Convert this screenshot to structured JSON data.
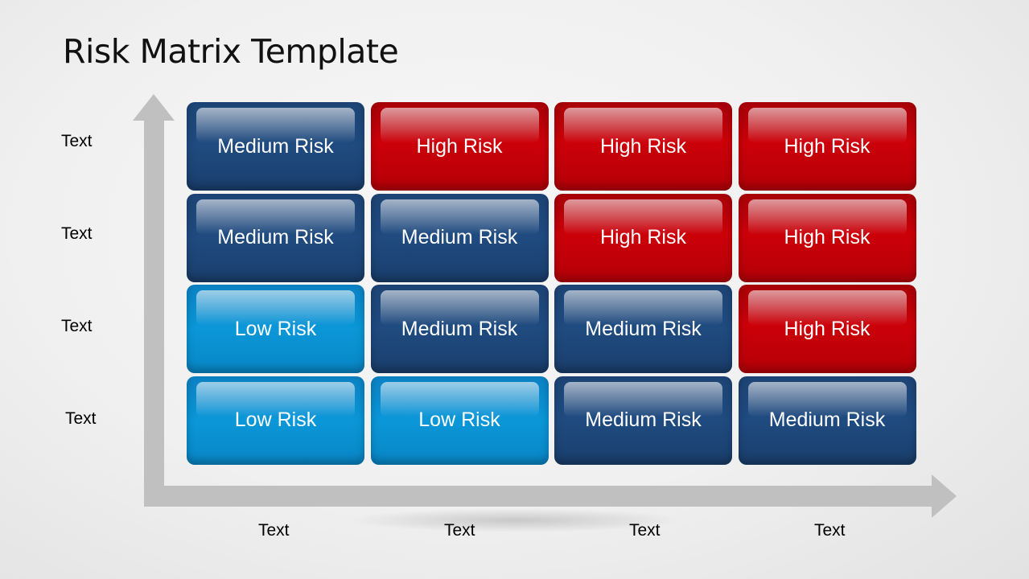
{
  "title": "Risk Matrix Template",
  "colors": {
    "medium": "#1f4b80",
    "high": "#cc0009",
    "low": "#0a97d8",
    "axis": "#c0c0c0"
  },
  "y_labels": [
    "Text",
    "Text",
    "Text",
    "Text"
  ],
  "x_labels": [
    "Text",
    "Text",
    "Text",
    "Text"
  ],
  "matrix": [
    [
      {
        "label": "Medium Risk",
        "level": "medium"
      },
      {
        "label": "High Risk",
        "level": "high"
      },
      {
        "label": "High Risk",
        "level": "high"
      },
      {
        "label": "High Risk",
        "level": "high"
      }
    ],
    [
      {
        "label": "Medium Risk",
        "level": "medium"
      },
      {
        "label": "Medium Risk",
        "level": "medium"
      },
      {
        "label": "High Risk",
        "level": "high"
      },
      {
        "label": "High Risk",
        "level": "high"
      }
    ],
    [
      {
        "label": "Low Risk",
        "level": "low"
      },
      {
        "label": "Medium Risk",
        "level": "medium"
      },
      {
        "label": "Medium Risk",
        "level": "medium"
      },
      {
        "label": "High Risk",
        "level": "high"
      }
    ],
    [
      {
        "label": "Low Risk",
        "level": "low"
      },
      {
        "label": "Low Risk",
        "level": "low"
      },
      {
        "label": "Medium Risk",
        "level": "medium"
      },
      {
        "label": "Medium Risk",
        "level": "medium"
      }
    ]
  ]
}
